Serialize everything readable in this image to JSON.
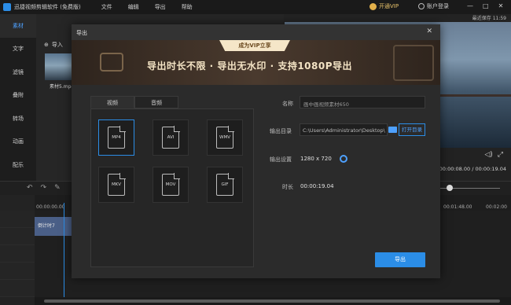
{
  "app": {
    "title": "迅捷视频剪辑软件 (免费版)",
    "menu": [
      "文件",
      "编辑",
      "导出",
      "帮助"
    ],
    "vip_label": "开通VIP",
    "account_label": "账户登录"
  },
  "sidebar": {
    "items": [
      {
        "label": "素材",
        "active": true
      },
      {
        "label": "文字"
      },
      {
        "label": "滤镜"
      },
      {
        "label": "叠附"
      },
      {
        "label": "转场"
      },
      {
        "label": "动画"
      },
      {
        "label": "配乐"
      }
    ]
  },
  "media": {
    "import_label": "导入",
    "items": [
      {
        "label": "素材5.mp4"
      }
    ]
  },
  "preview": {
    "header": "最近保存 11:59",
    "timecode": "00:00:08.00 / 00:00:19.04"
  },
  "timeline": {
    "ruler": [
      "00:00:00.00",
      "00:01:48.00",
      "00:02:00"
    ],
    "clip_label": "倒计时7"
  },
  "export_dialog": {
    "title": "导出",
    "banner": {
      "ribbon": "成为VIP立享",
      "headline": "导出时长不限 · 导出无水印 · 支持1080P导出"
    },
    "tabs": [
      "视频",
      "音频"
    ],
    "active_tab": 0,
    "formats": [
      "MP4",
      "AVI",
      "WMV",
      "MKV",
      "MOV",
      "GIF"
    ],
    "selected_format": "MP4",
    "fields": {
      "name_label": "名称",
      "name_value": "画中画视频素材650",
      "dir_label": "输出目录",
      "dir_value": "C:\\Users\\Administrator\\Desktop\\",
      "open_dir_label": "打开目录",
      "settings_label": "输出设置",
      "settings_value": "1280 x 720",
      "duration_label": "时长",
      "duration_value": "00:00:19.04"
    },
    "export_button": "导出"
  },
  "colors": {
    "accent": "#2b8de6",
    "vip_gold": "#e2b04a"
  }
}
